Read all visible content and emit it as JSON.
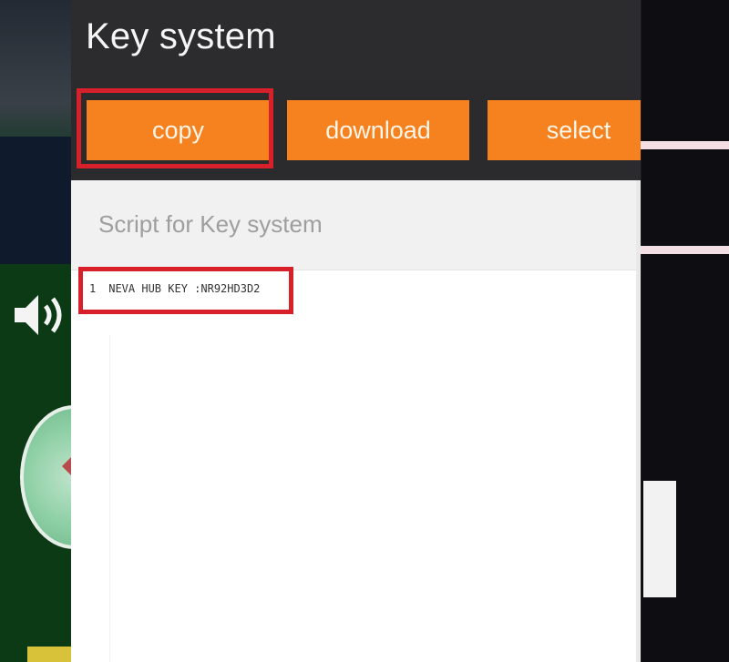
{
  "dialog": {
    "title": "Key system",
    "buttons": {
      "copy": "copy",
      "download": "download",
      "select": "select"
    },
    "name_field": "Script for Key system",
    "code": {
      "line_number": "1",
      "text": "NEVA HUB KEY :NR92HD3D2"
    }
  },
  "colors": {
    "accent_orange": "#f5821f",
    "title_bar": "#2c2c2e",
    "highlight_red": "#d8202b"
  },
  "icons": [
    "speaker-icon",
    "joystick-icon"
  ]
}
